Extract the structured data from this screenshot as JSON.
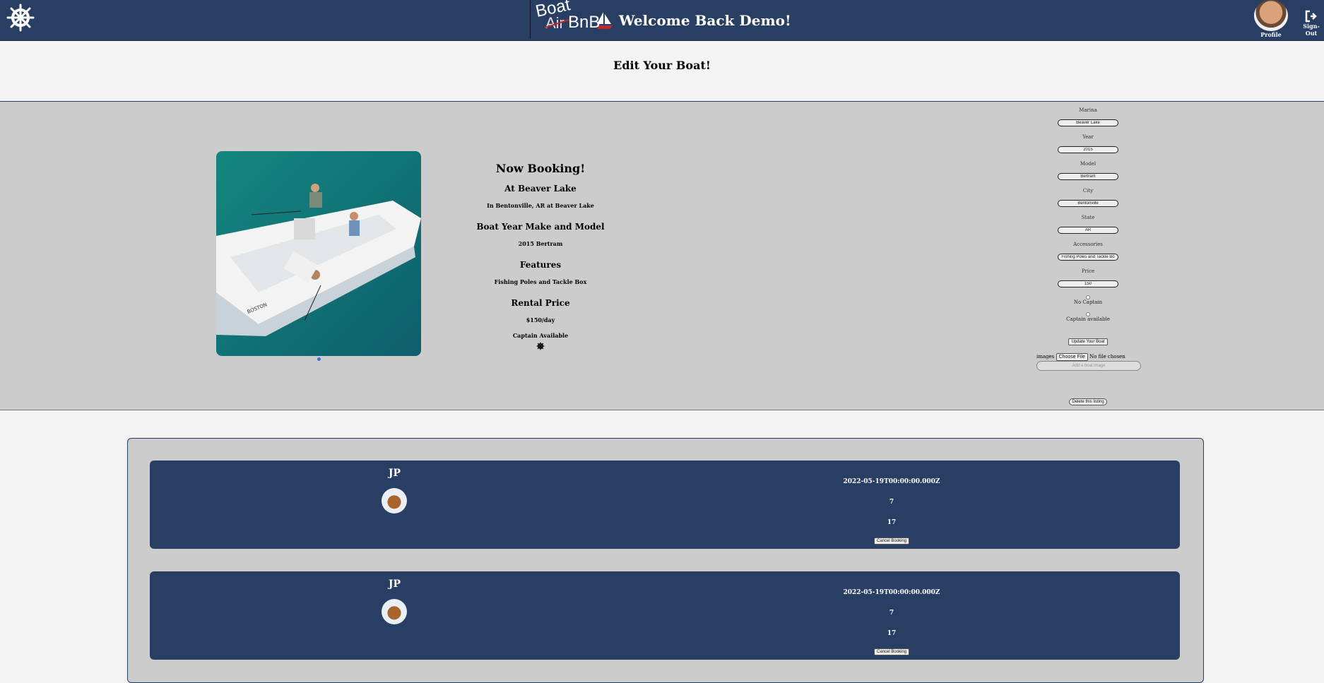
{
  "header": {
    "logo": {
      "boat": "Boat",
      "air": "Air",
      "bnb": "BnB"
    },
    "welcome": "Welcome Back Demo!",
    "profile_label": "Profile",
    "signout_label": "Sign-Out"
  },
  "page_title": "Edit Your Boat!",
  "listing": {
    "now_booking": "Now Booking!",
    "at_marina": "At Beaver Lake",
    "location": "In Bentonville, AR at Beaver Lake",
    "year_make_heading": "Boat Year Make and Model",
    "year_make": "2015 Bertram",
    "features_heading": "Features",
    "features": "Fishing Poles and Tackle Box",
    "price_heading": "Rental Price",
    "price": "$150/day",
    "captain": "Captain Available"
  },
  "form": {
    "marina": {
      "label": "Marina",
      "value": "Beaver Lake"
    },
    "year": {
      "label": "Year",
      "value": "2015"
    },
    "model": {
      "label": "Model",
      "value": "Bertram"
    },
    "city": {
      "label": "City",
      "value": "Bentonville"
    },
    "state": {
      "label": "State",
      "value": "AR"
    },
    "accessories": {
      "label": "Accessories",
      "value": "Fishing Poles and Tackle Bo"
    },
    "price": {
      "label": "Price",
      "value": "150"
    },
    "no_captain_label": "No Captain",
    "captain_label": "Captain available",
    "update_button": "Update Your Boat",
    "images_label": "images",
    "choose_file": "Choose File",
    "no_file": "No file chosen",
    "add_image_placeholder": "Add a boat image",
    "delete_button": "Delete this listing"
  },
  "bookings": [
    {
      "name": "JP",
      "date": "2022-05-19T00:00:00.000Z",
      "value1": "7",
      "value2": "17",
      "cancel": "Cancel Booking"
    },
    {
      "name": "JP",
      "date": "2022-05-19T00:00:00.000Z",
      "value1": "7",
      "value2": "17",
      "cancel": "Cancel Booking"
    }
  ],
  "colors": {
    "header_bg": "#283f63",
    "panel_bg": "#cccccc",
    "page_bg": "#f4f4f4",
    "water": "#127a80"
  }
}
